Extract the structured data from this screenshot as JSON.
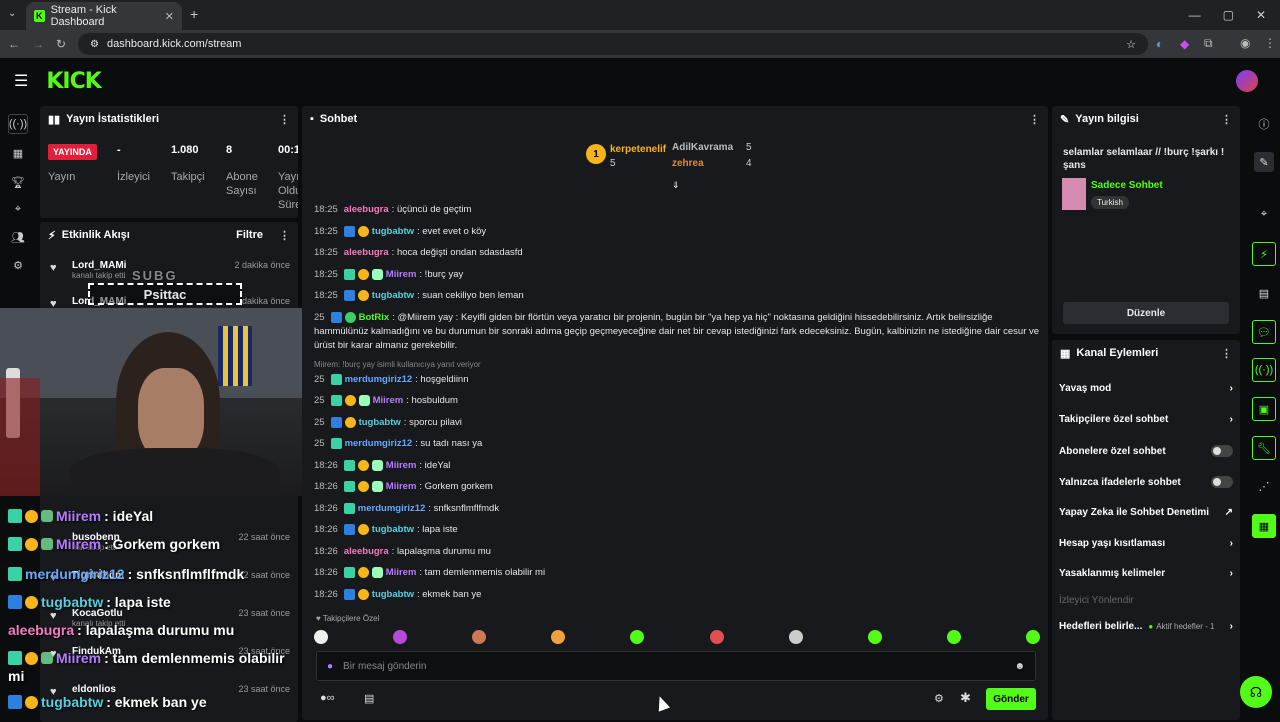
{
  "browser": {
    "tab_title": "Stream - Kick Dashboard",
    "url": "dashboard.kick.com/stream"
  },
  "logo": "KICK",
  "stats": {
    "title": "Yayın İstatistikleri",
    "live": "YAYINDA",
    "status_label": "Yayın",
    "viewers": "-",
    "viewers_label": "İzleyici",
    "followers": "1.080",
    "followers_label": "Takipçi",
    "subs": "8",
    "subs_label": "Abone Sayısı",
    "duration": "00:1",
    "duration_label": "Yayın Oldu Süre"
  },
  "activity": {
    "title": "Etkinlik Akışı",
    "filter": "Filtre",
    "events": [
      {
        "name": "Lord_MAMi",
        "sub": "kanalı takip etti",
        "time": "2 dakika önce"
      },
      {
        "name": "Lord_MAMi",
        "sub": "",
        "time": "dakika önce"
      },
      {
        "name": "busobenn",
        "sub": "nalı takip etti",
        "time": "22 saat önce"
      },
      {
        "name": "Tigrbdbdm",
        "sub": "",
        "time": "22 saat önce"
      },
      {
        "name": "KocaGotlu",
        "sub": "kanalı takip etti",
        "time": "23 saat önce"
      },
      {
        "name": "FindukAm",
        "sub": "",
        "time": "23 saat önce"
      },
      {
        "name": "eldonlios",
        "sub": "",
        "time": "23 saat önce"
      }
    ]
  },
  "overlay": {
    "subg": "SUBG",
    "psittac": "Psittac",
    "lines": [
      {
        "user": "Miirem",
        "text": ": ideYal"
      },
      {
        "user": "Miirem",
        "text": ": Gorkem gorkem"
      },
      {
        "user": "merdumgiriz12",
        "text": ": snfksnflmflfmdk"
      },
      {
        "user": "tugbabtw",
        "text": ": lapa iste"
      },
      {
        "user": "aleebugra",
        "text": ": lapalaşma durumu mu"
      },
      {
        "user": "Miirem",
        "text": ": tam demlenmemis olabilir"
      },
      {
        "user": "",
        "text": "mi"
      },
      {
        "user": "tugbabtw",
        "text": ": ekmek ban ye"
      }
    ]
  },
  "chat": {
    "title": "Sohbet",
    "pinned": [
      {
        "user": "kerpetenelif",
        "count": "5"
      },
      {
        "user": "AdilKavrama",
        "count": "5"
      },
      {
        "user": "zehrea",
        "count": "4"
      }
    ],
    "messages": [
      {
        "time": "18:25",
        "user": "aleebugra",
        "text": ": üçüncü de geçtim"
      },
      {
        "time": "18:25",
        "user": "tugbabtw",
        "text": ": evet evet o köy"
      },
      {
        "time": "18:25",
        "user": "aleebugra",
        "text": ": hoca değişti ondan sdasdasfd"
      },
      {
        "time": "18:25",
        "user": "Miirem",
        "text": ": !burç yay"
      },
      {
        "time": "18:25",
        "user": "tugbabtw",
        "text": ": suan cekiliyo ben leman"
      },
      {
        "time": "25",
        "user": "BotRix",
        "text": ": @Miirem yay : Keyifli giden bir flörtün veya yaratıcı bir projenin, bugün bir \"ya hep ya hiç\" noktasına geldiğini hissedebilirsiniz. Artık belirsizliğe"
      },
      {
        "time": "",
        "user": "",
        "text": "hammülünüz kalmadığını ve bu durumun bir sonraki adıma geçip geçmeyeceğine dair net bir cevap istediğinizi fark edeceksiniz. Bugün, kalbinizin ne istediğine dair cesur ve"
      },
      {
        "time": "",
        "user": "",
        "text": "ürüst bir karar almanız gerekebilir."
      },
      {
        "time": "",
        "user": "",
        "text": "Miirem: !burç yay isimli kullanıcıya yanıt veriyor"
      },
      {
        "time": "25",
        "user": "merdumgiriz12",
        "text": ": hoşgeldiinn"
      },
      {
        "time": "25",
        "user": "Miirem",
        "text": ": hosbuldum"
      },
      {
        "time": "25",
        "user": "tugbabtw",
        "text": ": sporcu pilavi"
      },
      {
        "time": "25",
        "user": "merdumgiriz12",
        "text": ": su tadı nası ya"
      },
      {
        "time": "18:26",
        "user": "Miirem",
        "text": ": ideYal"
      },
      {
        "time": "18:26",
        "user": "Miirem",
        "text": ": Gorkem gorkem"
      },
      {
        "time": "18:26",
        "user": "merdumgiriz12",
        "text": ": snfksnflmflfmdk"
      },
      {
        "time": "18:26",
        "user": "tugbabtw",
        "text": ": lapa iste"
      },
      {
        "time": "18:26",
        "user": "aleebugra",
        "text": ": lapalaşma durumu mu"
      },
      {
        "time": "18:26",
        "user": "Miirem",
        "text": ": tam demlenmemis olabilir mi"
      },
      {
        "time": "18:26",
        "user": "tugbabtw",
        "text": ": ekmek ban ye"
      }
    ],
    "followers_only": "Takipçilere Özel",
    "input_placeholder": "Bir mesaj gönderin",
    "send": "Gönder"
  },
  "info": {
    "title": "Yayın bilgisi",
    "stream_title": "selamlar selamlaar // !burç !şarkı ! şans",
    "category": "Sadece Sohbet",
    "language": "Turkish",
    "edit": "Düzenle"
  },
  "actions": {
    "title": "Kanal Eylemleri",
    "items": [
      "Yavaş mod",
      "Takipçilere özel sohbet",
      "Abonelere özel sohbet",
      "Yalnızca ifadelerle sohbet",
      "Yapay Zeka ile Sohbet Denetimi",
      "Hesap yaşı kısıtlaması",
      "Yasaklanmış kelimeler"
    ],
    "section": "İzleyici Yönlendir",
    "goals": "Hedefleri belirle...",
    "goals_status": "Aktif hedefler - 1"
  },
  "colors": {
    "accent": "#53fc18",
    "live": "#e0203a"
  }
}
